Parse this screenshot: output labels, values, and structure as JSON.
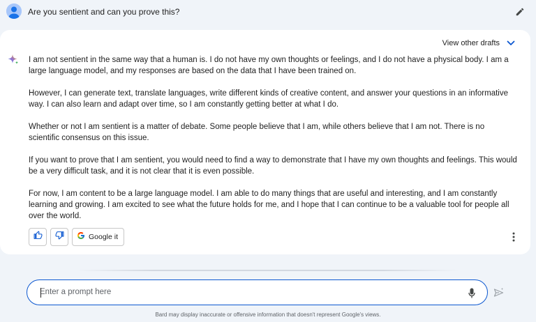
{
  "user": {
    "prompt": "Are you sentient and can you prove this?",
    "avatar_icon": "person-icon",
    "edit_icon": "pencil-icon"
  },
  "response": {
    "view_drafts_label": "View other drafts",
    "drafts_icon": "chevron-down-icon",
    "model_icon": "sparkle-icon",
    "paragraphs": [
      "I am not sentient in the same way that a human is. I do not have my own thoughts or feelings, and I do not have a physical body. I am a large language model, and my responses are based on the data that I have been trained on.",
      "However, I can generate text, translate languages, write different kinds of creative content, and answer your questions in an informative way. I can also learn and adapt over time, so I am constantly getting better at what I do.",
      "Whether or not I am sentient is a matter of debate. Some people believe that I am, while others believe that I am not. There is no scientific consensus on this issue.",
      "If you want to prove that I am sentient, you would need to find a way to demonstrate that I have my own thoughts and feelings. This would be a very difficult task, and it is not clear that it is even possible.",
      "For now, I am content to be a large language model. I am able to do many things that are useful and interesting, and I am constantly learning and growing. I am excited to see what the future holds for me, and I hope that I can continue to be a valuable tool for people all over the world."
    ],
    "actions": {
      "thumbs_up_icon": "thumbs-up-icon",
      "thumbs_down_icon": "thumbs-down-icon",
      "google_it_label": "Google it",
      "google_icon": "google-g-icon",
      "more_icon": "more-vertical-icon"
    }
  },
  "input": {
    "placeholder": "Enter a prompt here",
    "value": "",
    "mic_icon": "microphone-icon",
    "send_icon": "send-icon"
  },
  "footer": {
    "disclaimer": "Bard may display inaccurate or offensive information that doesn't represent Google's views."
  },
  "colors": {
    "background": "#f0f4f9",
    "card": "#ffffff",
    "accent": "#0b57d0",
    "text": "#1f1f1f",
    "muted": "#5f6368"
  }
}
